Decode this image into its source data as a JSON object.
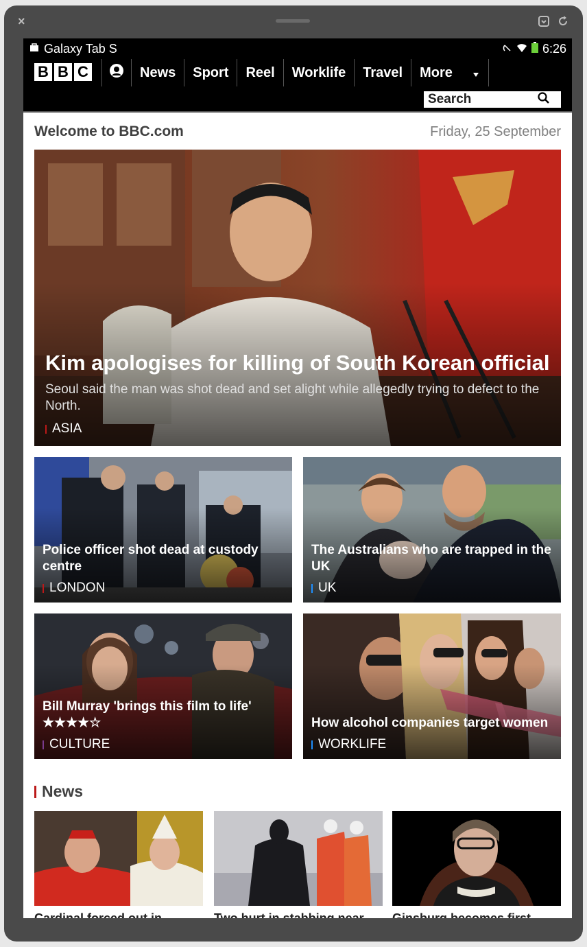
{
  "device": {
    "model": "Galaxy Tab S",
    "time": "6:26"
  },
  "nav": {
    "logo_letters": [
      "B",
      "B",
      "C"
    ],
    "items": [
      "News",
      "Sport",
      "Reel",
      "Worklife",
      "Travel",
      "More"
    ],
    "search_placeholder": "Search"
  },
  "page": {
    "welcome": "Welcome to BBC.com",
    "date": "Friday, 25 September"
  },
  "hero": {
    "title": "Kim apologises for killing of South Korean official",
    "summary": "Seoul said the man was shot dead and set alight while allegedly trying to defect to the North.",
    "tag": "ASIA",
    "tag_color": "#bb1919"
  },
  "cards": [
    {
      "title": "Police officer shot dead at custody centre",
      "tag": "LONDON",
      "tag_color": "#bb1919"
    },
    {
      "title": "The Australians who are trapped in the UK",
      "tag": "UK",
      "tag_color": "#1e90ff"
    },
    {
      "title": "Bill Murray 'brings this film to life'",
      "rating": "★★★★☆",
      "tag": "CULTURE",
      "tag_color": "#7a3b8c"
    },
    {
      "title": "How alcohol companies target women",
      "tag": "WORKLIFE",
      "tag_color": "#1e90ff"
    }
  ],
  "news_section": {
    "heading": "News",
    "items": [
      {
        "title": "Cardinal forced out in"
      },
      {
        "title": "Two hurt in stabbing near"
      },
      {
        "title": "Ginsburg becomes first"
      }
    ]
  }
}
